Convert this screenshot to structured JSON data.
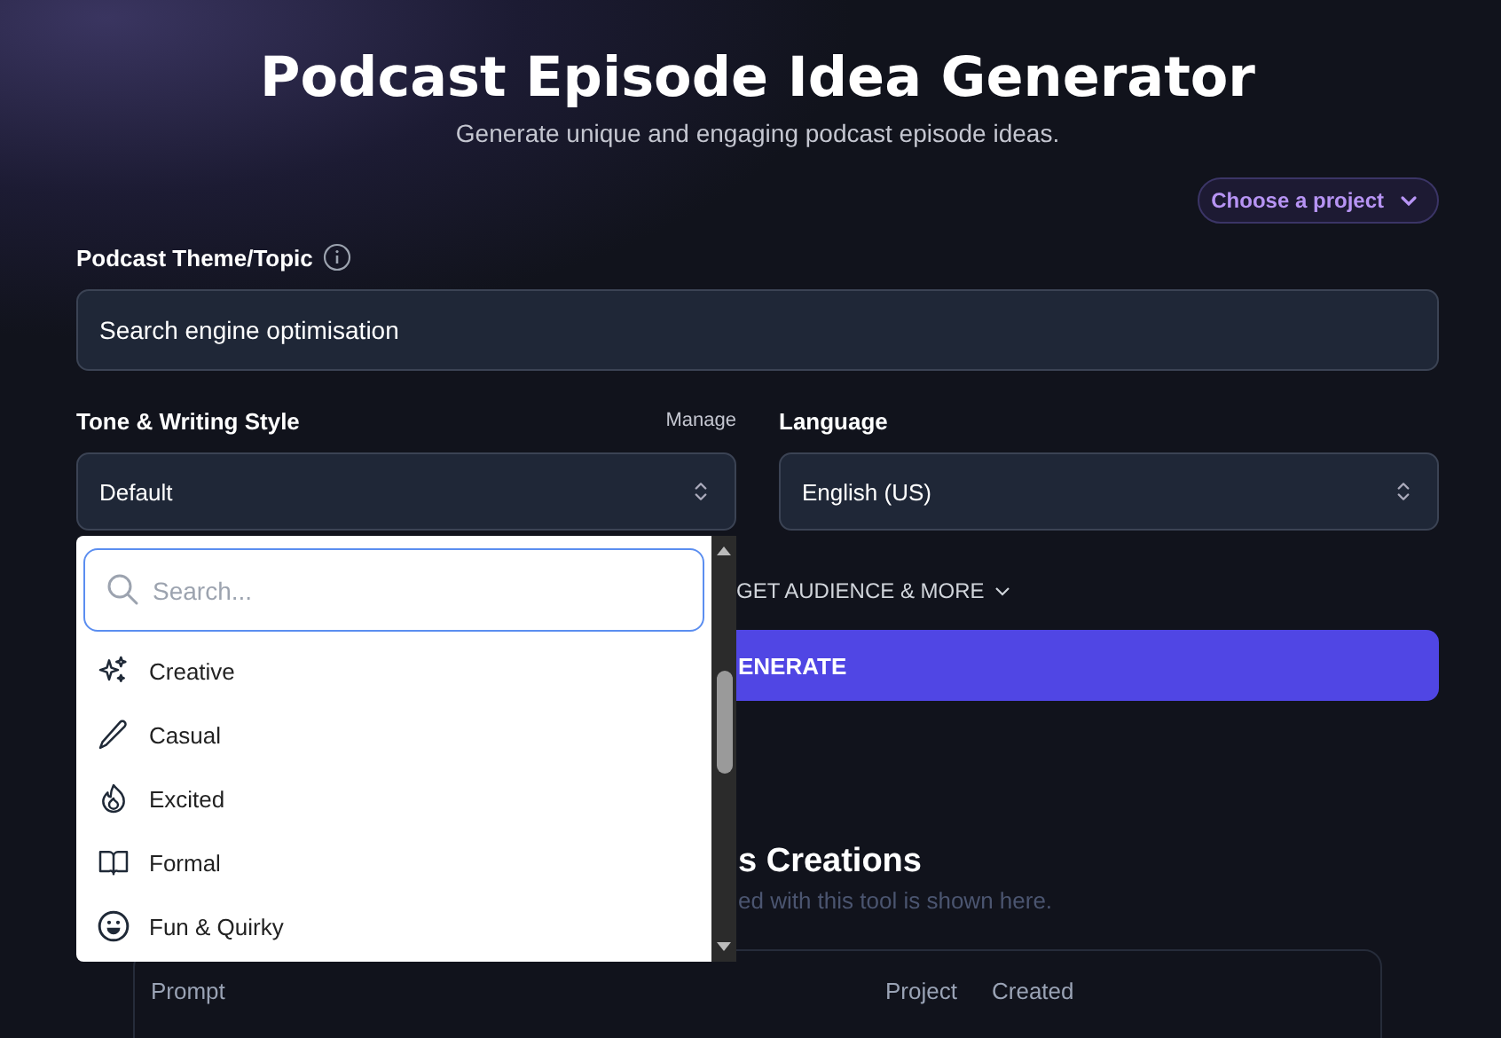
{
  "header": {
    "title": "Podcast Episode Idea Generator",
    "subtitle": "Generate unique and engaging podcast episode ideas."
  },
  "project_button": {
    "label": "Choose a project"
  },
  "topic": {
    "label": "Podcast Theme/Topic",
    "value": "Search engine optimisation"
  },
  "tone": {
    "label": "Tone & Writing Style",
    "manage_link": "Manage",
    "value": "Default"
  },
  "language": {
    "label": "Language",
    "value": "English (US)"
  },
  "advanced_toggle": {
    "label": "GET AUDIENCE & MORE"
  },
  "generate_button": {
    "label": "ENERATE"
  },
  "creations": {
    "title": "s Creations",
    "subtitle": "ed with this tool is shown here.",
    "table": {
      "columns": [
        "Prompt",
        "Project",
        "Created"
      ]
    }
  },
  "tone_dropdown": {
    "search": {
      "placeholder": "Search..."
    },
    "options": [
      {
        "label": "Creative",
        "kind": "sparkles"
      },
      {
        "label": "Casual",
        "kind": "pencil"
      },
      {
        "label": "Excited",
        "kind": "flame"
      },
      {
        "label": "Formal",
        "kind": "book"
      },
      {
        "label": "Fun & Quirky",
        "kind": "smile"
      }
    ]
  }
}
